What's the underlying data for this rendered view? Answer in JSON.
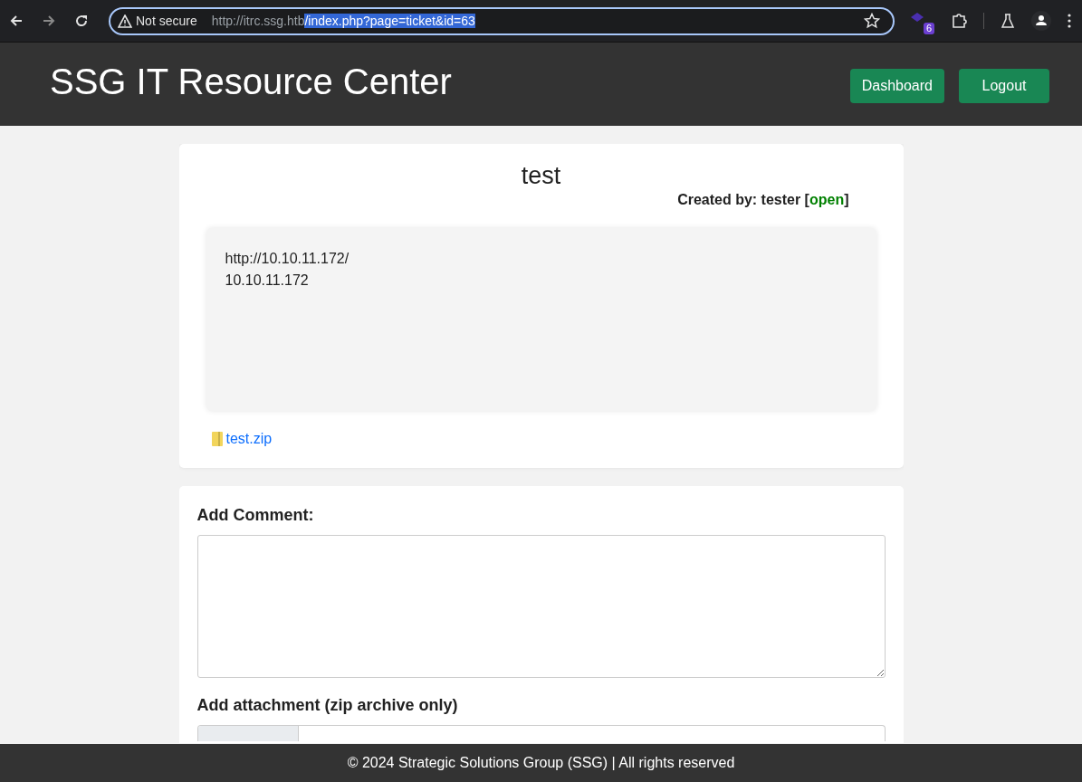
{
  "browser": {
    "security": "Not secure",
    "url_host": "http://itrc.ssg.htb",
    "url_path": "/index.php?page=ticket&id=63",
    "url_path_selected": true,
    "extension_badge": "6"
  },
  "header": {
    "title": "SSG IT Resource Center",
    "buttons": [
      "Dashboard",
      "Logout"
    ]
  },
  "ticket": {
    "title": "test",
    "created_by": "Created by: tester [",
    "status": "open",
    "created_by_end": "]",
    "body_lines": [
      "http://10.10.11.172/",
      "10.10.11.172"
    ],
    "attachment": "test.zip"
  },
  "comment_form": {
    "comment_label": "Add Comment:",
    "attachment_label": "Add attachment (zip archive only)"
  },
  "footer": "© 2024 Strategic Solutions Group (SSG) | All rights reserved"
}
